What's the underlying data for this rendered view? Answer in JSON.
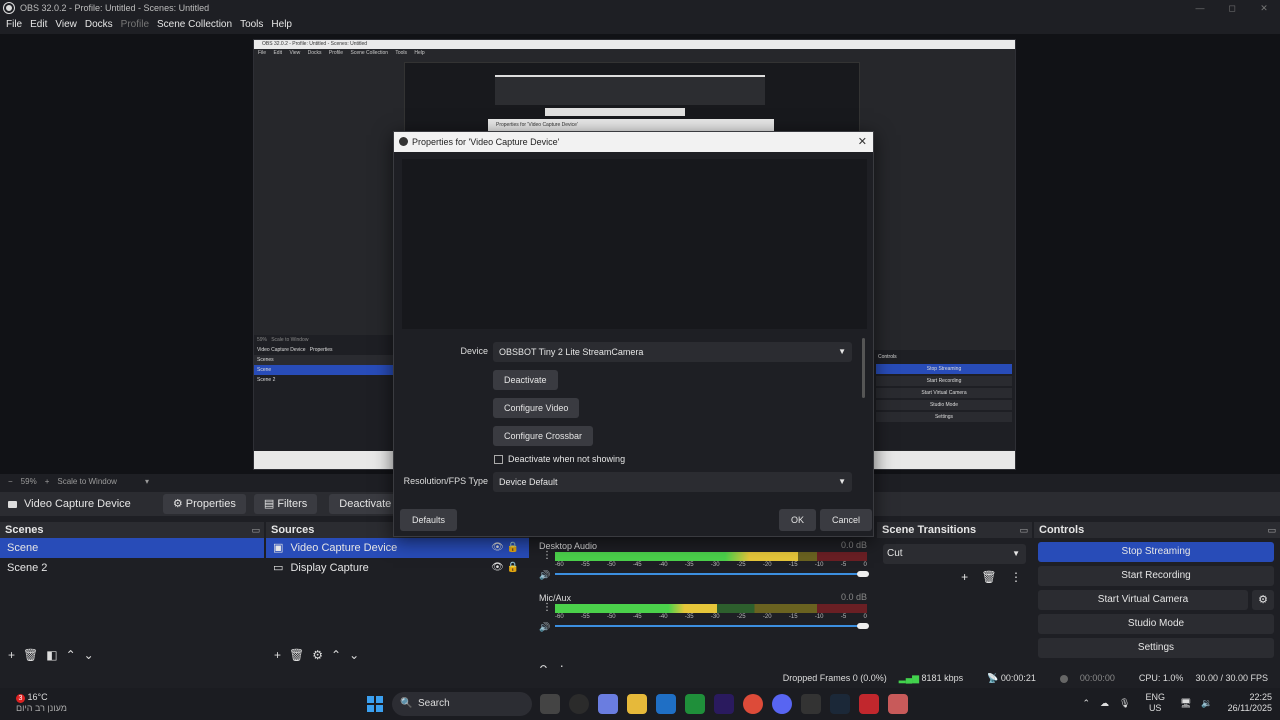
{
  "window": {
    "title": "OBS 32.0.2 - Profile: Untitled - Scenes: Untitled",
    "minimize": "—",
    "maximize": "◻",
    "close": "✕"
  },
  "menu": [
    "File",
    "Edit",
    "View",
    "Docks",
    "Profile",
    "Scene Collection",
    "Tools",
    "Help"
  ],
  "preview_nested": {
    "title": "OBS 32.0.2 - Profile: Untitled - Scenes: Untitled",
    "menu": [
      "File",
      "Edit",
      "View",
      "Docks",
      "Profile",
      "Scene Collection",
      "Tools",
      "Help"
    ],
    "zoom": "59%",
    "scale": "Scale to Window",
    "source": "Video Capture Device",
    "properties": "Properties",
    "dialog_title": "Properties for 'Video Capture Device'",
    "scenes_header": "Scenes",
    "scenes": [
      "Scene",
      "Scene 2"
    ],
    "controls_header": "Controls",
    "controls": [
      "Stop Streaming",
      "Start Recording",
      "Start Virtual Camera",
      "Studio Mode",
      "Settings"
    ]
  },
  "zoom_bar": {
    "minus": "−",
    "zoom": "59%",
    "plus": "+",
    "scale_mode": "Scale to Window",
    "dropdown": "▾"
  },
  "source_toolbar": {
    "source_name": "Video Capture Device",
    "properties": "Properties",
    "filters": "Filters",
    "deactivate": "Deactivate"
  },
  "scenes": {
    "header": "Scenes",
    "items": [
      "Scene",
      "Scene 2"
    ],
    "selected": 0
  },
  "sources": {
    "header": "Sources",
    "items": [
      "Video Capture Device",
      "Display Capture"
    ],
    "selected": 0
  },
  "mixer": {
    "channels": [
      {
        "name": "Desktop Audio",
        "db": "0.0 dB",
        "level": 0.78
      },
      {
        "name": "Mic/Aux",
        "db": "0.0 dB",
        "level": 0.52
      }
    ],
    "ticks": [
      "-60",
      "-55",
      "-50",
      "-45",
      "-40",
      "-35",
      "-30",
      "-25",
      "-20",
      "-15",
      "-10",
      "-5",
      "0"
    ]
  },
  "transitions": {
    "header": "Scene Transitions",
    "selected": "Cut"
  },
  "controls": {
    "header": "Controls",
    "stop_streaming": "Stop Streaming",
    "start_recording": "Start Recording",
    "start_virtual_camera": "Start Virtual Camera",
    "studio_mode": "Studio Mode",
    "settings": "Settings"
  },
  "status": {
    "dropped_frames": "Dropped Frames 0 (0.0%)",
    "bitrate": "8181 kbps",
    "stream_time": "00:00:21",
    "rec_time": "00:00:00",
    "cpu": "CPU: 1.0%",
    "fps": "30.00 / 30.00 FPS"
  },
  "dialog": {
    "title": "Properties for 'Video Capture Device'",
    "device_label": "Device",
    "device_value": "OBSBOT Tiny 2 Lite StreamCamera",
    "deactivate": "Deactivate",
    "configure_video": "Configure Video",
    "configure_crossbar": "Configure Crossbar",
    "deactivate_not_showing": "Deactivate when not showing",
    "resfps_label": "Resolution/FPS Type",
    "resfps_value": "Device Default",
    "defaults": "Defaults",
    "ok": "OK",
    "cancel": "Cancel"
  },
  "taskbar": {
    "weather_temp": "16°C",
    "weather_desc": "מעונן רב היום",
    "weather_badge": "3",
    "search": "Search",
    "lang_top": "ENG",
    "lang_bottom": "US",
    "time": "22:25",
    "date": "26/11/2025"
  },
  "colors": {
    "accent": "#284cb8",
    "panel": "#1e1f24",
    "header": "#2b2c31",
    "meter_green": "#4bd14b",
    "meter_yellow": "#e6c63a"
  }
}
